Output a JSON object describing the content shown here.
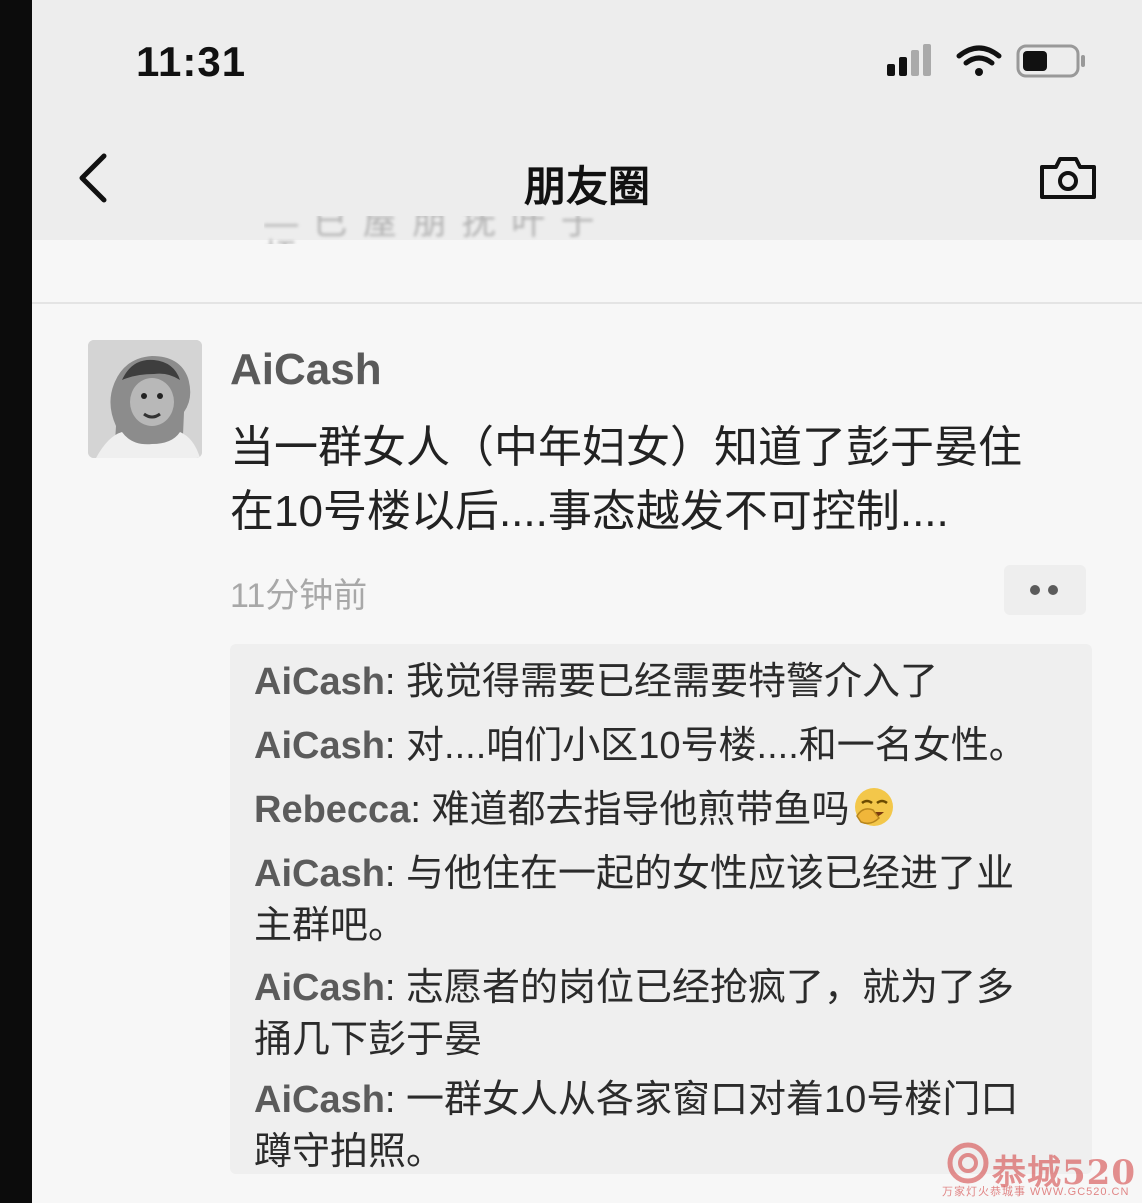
{
  "status_bar": {
    "time": "11:31"
  },
  "nav": {
    "title": "朋友圈"
  },
  "post": {
    "author": "AiCash",
    "text_line1": "当一群女人（中年妇女）知道了彭于晏住",
    "text_line2": "在10号楼以后....事态越发不可控制....",
    "time": "11分钟前"
  },
  "comments": [
    {
      "name": "AiCash",
      "sep": ": ",
      "text": "我觉得需要已经需要特警介入了"
    },
    {
      "name": "AiCash",
      "sep": ": ",
      "text": "对....咱们小区10号楼....和一名女性。"
    },
    {
      "name": "Rebecca",
      "sep": ": ",
      "text": "难道都去指导他煎带鱼吗"
    },
    {
      "name": "AiCash",
      "sep": ": ",
      "text": "与他住在一起的女性应该已经进了业",
      "text2": "主群吧。"
    },
    {
      "name": "AiCash",
      "sep": ": ",
      "text": "志愿者的岗位已经抢疯了，就为了多",
      "text2": "捅几下彭于晏"
    },
    {
      "name": "AiCash",
      "sep": ": ",
      "text": "一群女人从各家窗口对着10号楼门口",
      "text2": "蹲守拍照。"
    }
  ],
  "watermark": {
    "text": "恭城520",
    "sub": "万家灯火恭城事  WWW.GC520.CN"
  },
  "icons": {
    "back": "chevron-left-icon",
    "camera": "camera-icon",
    "signal": "signal-icon",
    "wifi": "wifi-icon",
    "battery": "battery-icon",
    "emoji": "facepalm-laugh-emoji"
  },
  "colors": {
    "screen_bg": "#f7f7f7",
    "comment_bg": "#efefef",
    "name_color": "#5b5b5b"
  }
}
